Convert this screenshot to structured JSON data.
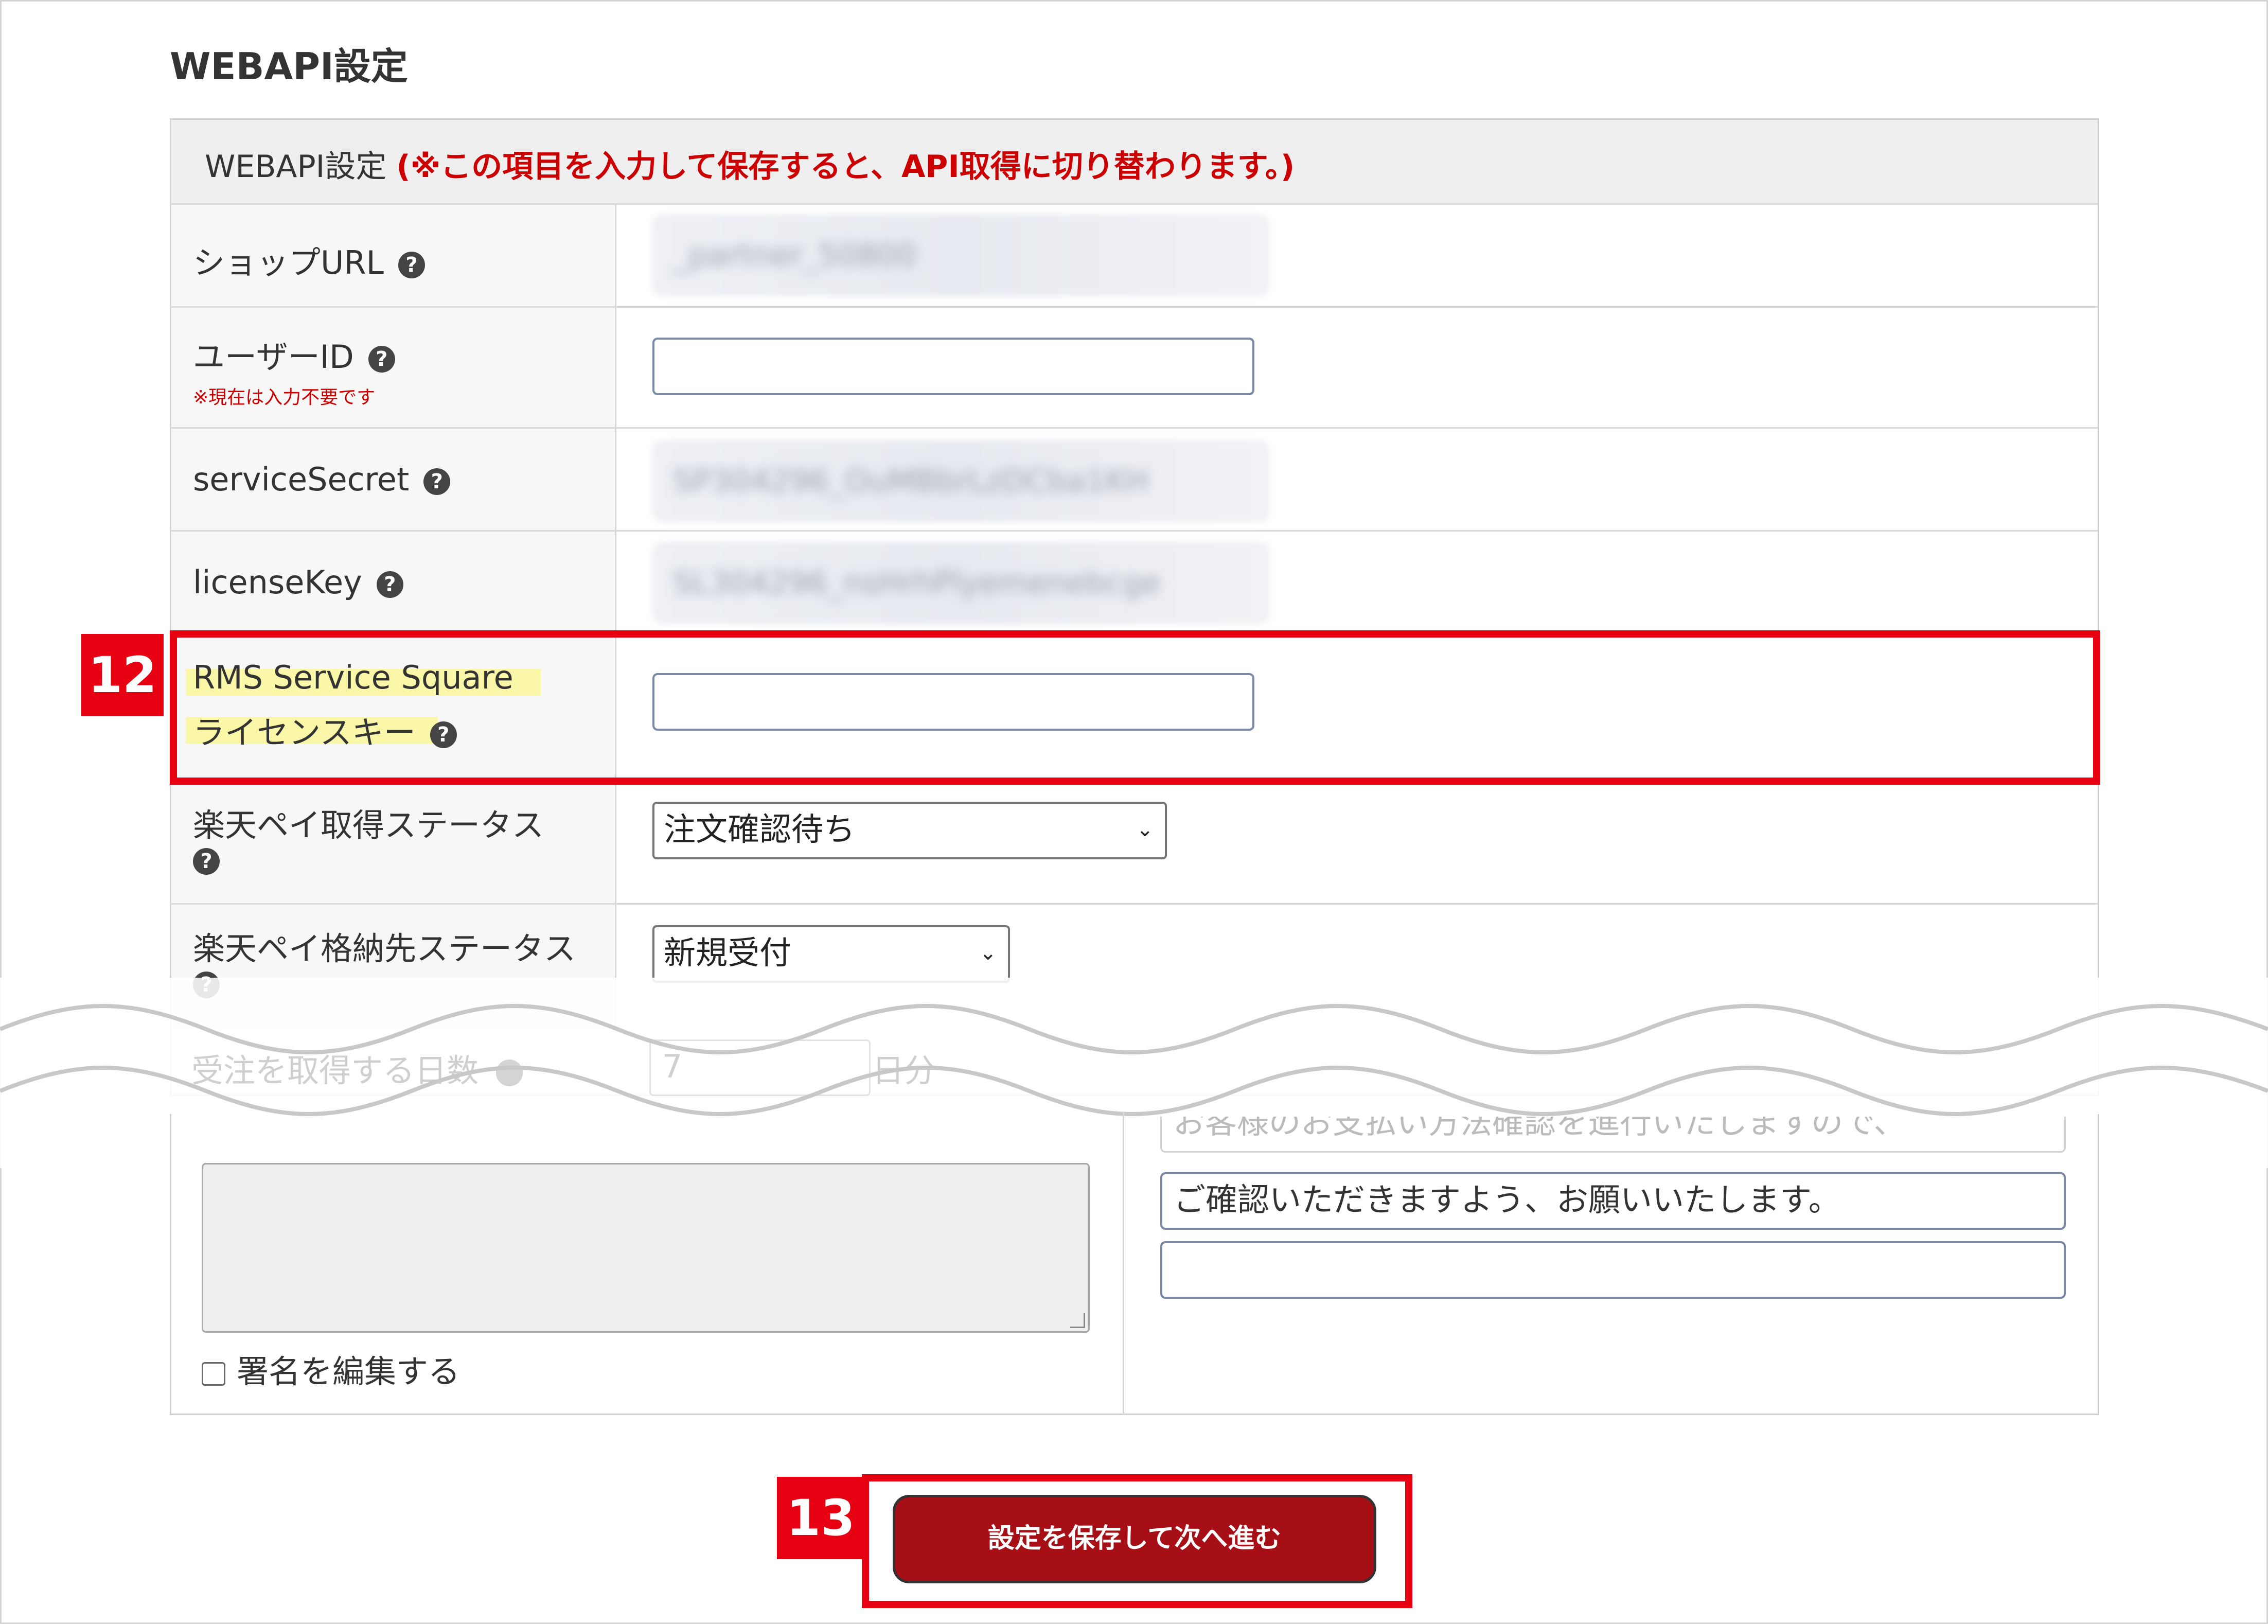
{
  "page_title": "WEBAPI設定",
  "table_header": {
    "label": "WEBAPI設定",
    "note": "(※この項目を入力して保存すると、API取得に切り替わります。)"
  },
  "rows": {
    "shop_url": {
      "label": "ショップURL",
      "value": "_partner_50800"
    },
    "user_id": {
      "label": "ユーザーID",
      "note": "※現在は入力不要です",
      "value": ""
    },
    "service_secret": {
      "label": "serviceSecret",
      "value": "SP304296_OuMBbrLzDCba1KH"
    },
    "license_key": {
      "label": "licenseKey",
      "value": "SL304296_nsHrhPlyemenebcge"
    },
    "rms_license": {
      "label_line1": "RMS Service Square",
      "label_line2": "ライセンスキー",
      "value": ""
    },
    "pay_status": {
      "label": "楽天ペイ取得ステータス",
      "selected": "注文確認待ち"
    },
    "pay_dest_status": {
      "label": "楽天ペイ格納先ステータス",
      "selected": "新規受付"
    },
    "fetch_days": {
      "label": "受注を取得する日数",
      "value": "7",
      "unit": "日分"
    }
  },
  "message": {
    "partial_line": "お客様のお支払い方法確認を進行いたしますので、",
    "line2": "ご確認いただきますよう、お願いいたします。",
    "line3": ""
  },
  "signature_checkbox_label": "署名を編集する",
  "save_button_label": "設定を保存して次へ進む",
  "callouts": {
    "step12": "12",
    "step13": "13"
  },
  "help_icon_glyph": "?",
  "colors": {
    "callout_red": "#e60012",
    "button_red": "#a50f15",
    "note_red": "#cc0000",
    "highlight": "#fbf7a8"
  }
}
